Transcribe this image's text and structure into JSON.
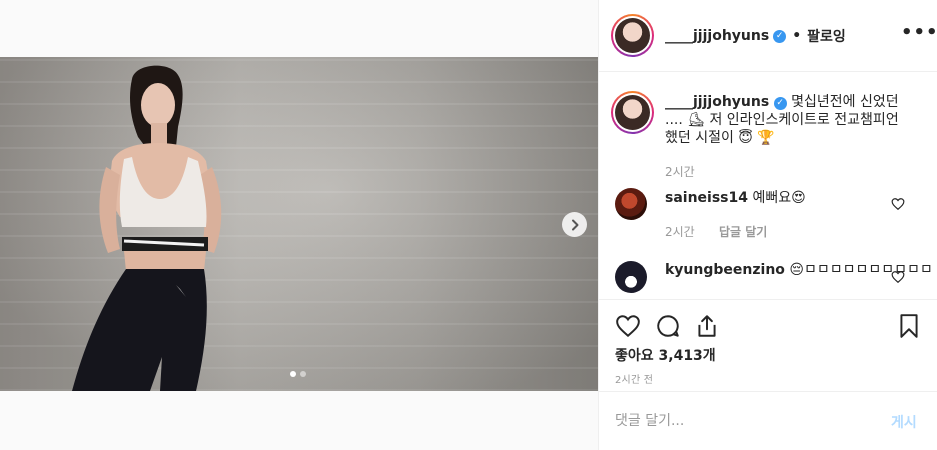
{
  "header": {
    "username": "____jjjjohyuns",
    "separator": "•",
    "follow_label": "팔로잉",
    "more_label": "•••"
  },
  "caption": {
    "username": "____jjjjohyuns",
    "text": "몇십년전에 신었던 .... ⛸ 저 인라인스케이트로 전교챔피언 했던 시절이 😇 🏆",
    "time": "2시간"
  },
  "comments": [
    {
      "username": "saineiss14",
      "text": "예뻐요😍",
      "time": "2시간",
      "reply_label": "답글 달기"
    },
    {
      "username": "kyungbeenzino",
      "text": "😔ㅁㅁㅁㅁㅁㅁㅁㅁㅁㅁ"
    }
  ],
  "likes_text": "좋아요 3,413개",
  "timestamp": "2시간 전",
  "comment_box": {
    "placeholder": "댓글 달기...",
    "post_label": "게시"
  },
  "carousel": {
    "total_slides": 2,
    "active_slide": 1
  },
  "colors": {
    "accent": "#3897f0",
    "post_button_disabled": "#b3dbff",
    "meta_text": "#999999",
    "border": "#efefef"
  }
}
